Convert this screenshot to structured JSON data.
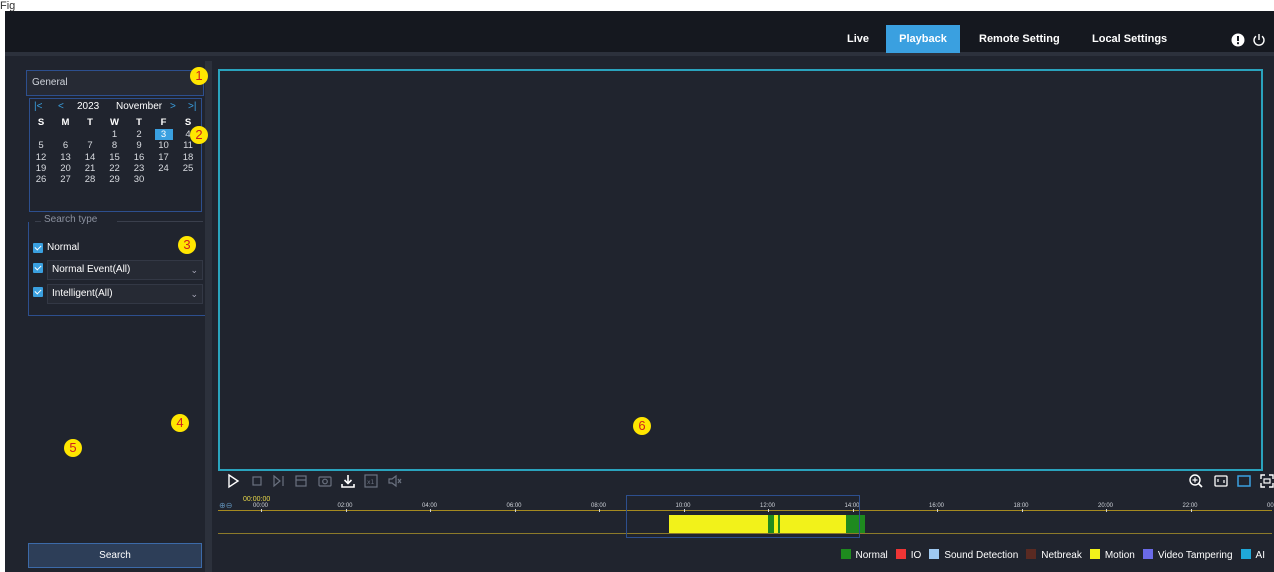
{
  "figure_label": "Fig",
  "header": {
    "nav": [
      {
        "label": "Live",
        "active": false
      },
      {
        "label": "Playback",
        "active": true
      },
      {
        "label": "Remote Setting",
        "active": false
      },
      {
        "label": "Local Settings",
        "active": false
      }
    ],
    "icons": [
      "alert-icon",
      "power-icon"
    ]
  },
  "sidebar": {
    "general_label": "General",
    "calendar": {
      "year": "2023",
      "month": "November",
      "weekdays": [
        "S",
        "M",
        "T",
        "W",
        "T",
        "F",
        "S"
      ],
      "days": [
        [
          "",
          "",
          "",
          "1",
          "2",
          "3",
          "4"
        ],
        [
          "5",
          "6",
          "7",
          "8",
          "9",
          "10",
          "11"
        ],
        [
          "12",
          "13",
          "14",
          "15",
          "16",
          "17",
          "18"
        ],
        [
          "19",
          "20",
          "21",
          "22",
          "23",
          "24",
          "25"
        ],
        [
          "26",
          "27",
          "28",
          "29",
          "30",
          "",
          ""
        ]
      ],
      "selected_day": "3"
    },
    "search_type": {
      "title": "Search type",
      "normal_label": "Normal",
      "normal_event_label": "Normal Event(All)",
      "intelligent_label": "Intelligent(All)"
    },
    "search_button": "Search"
  },
  "timeline": {
    "current_time": "00:00:00",
    "ticks": [
      "00:00",
      "02:00",
      "04:00",
      "06:00",
      "08:00",
      "10:00",
      "12:00",
      "14:00",
      "16:00",
      "18:00",
      "20:00",
      "22:00",
      "00:00"
    ],
    "recordings": [
      {
        "start_hour": 10.0,
        "end_hour": 12.35,
        "type": "Motion"
      },
      {
        "start_hour": 12.35,
        "end_hour": 12.5,
        "type": "Normal"
      },
      {
        "start_hour": 12.5,
        "end_hour": 12.6,
        "type": "Motion"
      },
      {
        "start_hour": 12.6,
        "end_hour": 12.65,
        "type": "Normal"
      },
      {
        "start_hour": 12.65,
        "end_hour": 14.2,
        "type": "Motion"
      },
      {
        "start_hour": 14.2,
        "end_hour": 14.65,
        "type": "Normal"
      }
    ],
    "legend": [
      {
        "label": "Normal",
        "color": "#1e8a1e"
      },
      {
        "label": "IO",
        "color": "#ee3535"
      },
      {
        "label": "Sound Detection",
        "color": "#9ec8f0"
      },
      {
        "label": "Netbreak",
        "color": "#5a2a22"
      },
      {
        "label": "Motion",
        "color": "#f2f21a"
      },
      {
        "label": "Video Tampering",
        "color": "#6a6ae8"
      },
      {
        "label": "AI",
        "color": "#1fa8d8"
      }
    ]
  },
  "playback_controls": [
    "play-icon",
    "stop-icon",
    "next-frame-icon",
    "clip-icon",
    "snapshot-icon",
    "download-icon",
    "speed-icon",
    "mute-icon"
  ],
  "view_controls": [
    "zoom-in-icon",
    "aspect-icon",
    "window-icon",
    "fullscreen-icon"
  ],
  "callouts": [
    "1",
    "2",
    "3",
    "4",
    "5",
    "6"
  ],
  "colors": {
    "accent": "#3aa0e0",
    "video_border": "#2aa3bd",
    "callout_bg": "#ffe600",
    "callout_text": "#d02020"
  }
}
